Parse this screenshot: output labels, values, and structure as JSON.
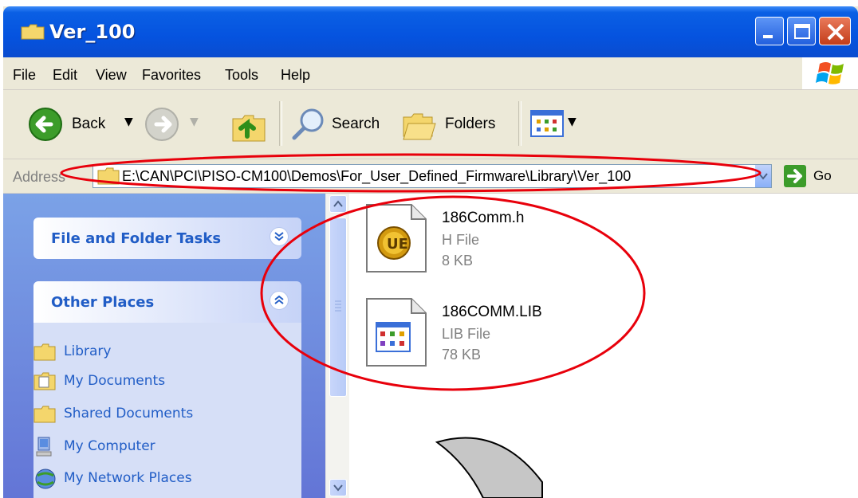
{
  "window": {
    "title": "Ver_100"
  },
  "menu": [
    "File",
    "Edit",
    "View",
    "Favorites",
    "Tools",
    "Help"
  ],
  "toolbar": {
    "back_label": "Back",
    "search_label": "Search",
    "folders_label": "Folders"
  },
  "address": {
    "label": "Address",
    "path": "E:\\CAN\\PCI\\PISO-CM100\\Demos\\For_User_Defined_Firmware\\Library\\Ver_100",
    "go_label": "Go"
  },
  "sidebar": {
    "file_tasks_title": "File and Folder Tasks",
    "other_places_title": "Other Places",
    "places": [
      "Library",
      "My Documents",
      "Shared Documents",
      "My Computer",
      "My Network Places"
    ]
  },
  "files": [
    {
      "name": "186Comm.h",
      "type": "H File",
      "size": "8 KB",
      "icon": "ultraedit-icon"
    },
    {
      "name": "186COMM.LIB",
      "type": "LIB File",
      "size": "78 KB",
      "icon": "lib-file-icon"
    }
  ],
  "colors": {
    "annotation": "#e8000b",
    "titlebar": "#0553df",
    "sidebar_link": "#215dc6",
    "sidebar_bg": "#6f8fe0"
  }
}
